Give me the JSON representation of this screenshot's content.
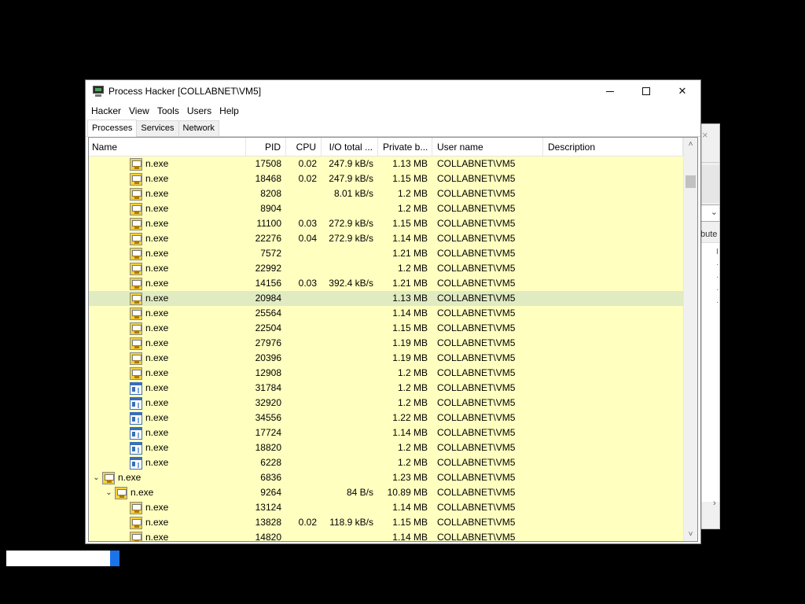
{
  "background_window": {
    "close_glyph": "×",
    "label": "bute",
    "combo_arrow": "⌄",
    "scroll_arrow": "›"
  },
  "window": {
    "title": "Process Hacker [COLLABNET\\VM5]",
    "controls": {
      "minimize": "",
      "maximize": "",
      "close": "✕"
    }
  },
  "menu": [
    "Hacker",
    "View",
    "Tools",
    "Users",
    "Help"
  ],
  "tabs": [
    {
      "label": "Processes",
      "active": true
    },
    {
      "label": "Services",
      "active": false
    },
    {
      "label": "Network",
      "active": false
    }
  ],
  "columns": {
    "name": "Name",
    "pid": "PID",
    "cpu": "CPU",
    "io": "I/O total ...",
    "priv": "Private b...",
    "user": "User name",
    "desc": "Description"
  },
  "colors": {
    "row_highlight": "#ffffc0",
    "selected_row": "#ececb4"
  },
  "rows": [
    {
      "indent": 3,
      "icon": "process-icon",
      "name": "n.exe",
      "pid": "17508",
      "cpu": "0.02",
      "io": "247.9 kB/s",
      "priv": "1.13 MB",
      "user": "COLLABNET\\VM5",
      "desc": ""
    },
    {
      "indent": 3,
      "icon": "process-icon",
      "name": "n.exe",
      "pid": "18468",
      "cpu": "0.02",
      "io": "247.9 kB/s",
      "priv": "1.15 MB",
      "user": "COLLABNET\\VM5",
      "desc": ""
    },
    {
      "indent": 3,
      "icon": "process-icon",
      "name": "n.exe",
      "pid": "8208",
      "cpu": "",
      "io": "8.01 kB/s",
      "priv": "1.2 MB",
      "user": "COLLABNET\\VM5",
      "desc": ""
    },
    {
      "indent": 3,
      "icon": "process-icon",
      "name": "n.exe",
      "pid": "8904",
      "cpu": "",
      "io": "",
      "priv": "1.2 MB",
      "user": "COLLABNET\\VM5",
      "desc": ""
    },
    {
      "indent": 3,
      "icon": "process-icon",
      "name": "n.exe",
      "pid": "11100",
      "cpu": "0.03",
      "io": "272.9 kB/s",
      "priv": "1.15 MB",
      "user": "COLLABNET\\VM5",
      "desc": ""
    },
    {
      "indent": 3,
      "icon": "process-icon",
      "name": "n.exe",
      "pid": "22276",
      "cpu": "0.04",
      "io": "272.9 kB/s",
      "priv": "1.14 MB",
      "user": "COLLABNET\\VM5",
      "desc": ""
    },
    {
      "indent": 3,
      "icon": "process-icon",
      "name": "n.exe",
      "pid": "7572",
      "cpu": "",
      "io": "",
      "priv": "1.21 MB",
      "user": "COLLABNET\\VM5",
      "desc": ""
    },
    {
      "indent": 3,
      "icon": "process-icon",
      "name": "n.exe",
      "pid": "22992",
      "cpu": "",
      "io": "",
      "priv": "1.2 MB",
      "user": "COLLABNET\\VM5",
      "desc": ""
    },
    {
      "indent": 3,
      "icon": "process-icon",
      "name": "n.exe",
      "pid": "14156",
      "cpu": "0.03",
      "io": "392.4 kB/s",
      "priv": "1.21 MB",
      "user": "COLLABNET\\VM5",
      "desc": ""
    },
    {
      "indent": 3,
      "icon": "process-icon",
      "name": "n.exe",
      "pid": "20984",
      "cpu": "",
      "io": "",
      "priv": "1.13 MB",
      "user": "COLLABNET\\VM5",
      "desc": "",
      "selected": true
    },
    {
      "indent": 3,
      "icon": "process-icon",
      "name": "n.exe",
      "pid": "25564",
      "cpu": "",
      "io": "",
      "priv": "1.14 MB",
      "user": "COLLABNET\\VM5",
      "desc": ""
    },
    {
      "indent": 3,
      "icon": "process-icon",
      "name": "n.exe",
      "pid": "22504",
      "cpu": "",
      "io": "",
      "priv": "1.15 MB",
      "user": "COLLABNET\\VM5",
      "desc": ""
    },
    {
      "indent": 3,
      "icon": "process-icon",
      "name": "n.exe",
      "pid": "27976",
      "cpu": "",
      "io": "",
      "priv": "1.19 MB",
      "user": "COLLABNET\\VM5",
      "desc": ""
    },
    {
      "indent": 3,
      "icon": "process-icon",
      "name": "n.exe",
      "pid": "20396",
      "cpu": "",
      "io": "",
      "priv": "1.19 MB",
      "user": "COLLABNET\\VM5",
      "desc": ""
    },
    {
      "indent": 3,
      "icon": "process-icon",
      "name": "n.exe",
      "pid": "12908",
      "cpu": "",
      "io": "",
      "priv": "1.2 MB",
      "user": "COLLABNET\\VM5",
      "desc": ""
    },
    {
      "indent": 3,
      "icon": "window-icon",
      "name": "n.exe",
      "pid": "31784",
      "cpu": "",
      "io": "",
      "priv": "1.2 MB",
      "user": "COLLABNET\\VM5",
      "desc": ""
    },
    {
      "indent": 3,
      "icon": "window-icon",
      "name": "n.exe",
      "pid": "32920",
      "cpu": "",
      "io": "",
      "priv": "1.2 MB",
      "user": "COLLABNET\\VM5",
      "desc": ""
    },
    {
      "indent": 3,
      "icon": "window-icon",
      "name": "n.exe",
      "pid": "34556",
      "cpu": "",
      "io": "",
      "priv": "1.22 MB",
      "user": "COLLABNET\\VM5",
      "desc": ""
    },
    {
      "indent": 3,
      "icon": "window-icon",
      "name": "n.exe",
      "pid": "17724",
      "cpu": "",
      "io": "",
      "priv": "1.14 MB",
      "user": "COLLABNET\\VM5",
      "desc": ""
    },
    {
      "indent": 3,
      "icon": "window-icon",
      "name": "n.exe",
      "pid": "18820",
      "cpu": "",
      "io": "",
      "priv": "1.2 MB",
      "user": "COLLABNET\\VM5",
      "desc": ""
    },
    {
      "indent": 3,
      "icon": "window-icon",
      "name": "n.exe",
      "pid": "6228",
      "cpu": "",
      "io": "",
      "priv": "1.2 MB",
      "user": "COLLABNET\\VM5",
      "desc": ""
    },
    {
      "indent": 0,
      "icon": "process-icon",
      "expander": "expanded",
      "name": "n.exe",
      "pid": "6836",
      "cpu": "",
      "io": "",
      "priv": "1.23 MB",
      "user": "COLLABNET\\VM5",
      "desc": ""
    },
    {
      "indent": 1,
      "icon": "process-icon",
      "expander": "expanded",
      "name": "n.exe",
      "pid": "9264",
      "cpu": "",
      "io": "84 B/s",
      "priv": "10.89 MB",
      "user": "COLLABNET\\VM5",
      "desc": ""
    },
    {
      "indent": 3,
      "icon": "process-icon",
      "name": "n.exe",
      "pid": "13124",
      "cpu": "",
      "io": "",
      "priv": "1.14 MB",
      "user": "COLLABNET\\VM5",
      "desc": ""
    },
    {
      "indent": 3,
      "icon": "process-icon",
      "name": "n.exe",
      "pid": "13828",
      "cpu": "0.02",
      "io": "118.9 kB/s",
      "priv": "1.15 MB",
      "user": "COLLABNET\\VM5",
      "desc": ""
    },
    {
      "indent": 3,
      "icon": "process-icon",
      "name": "n.exe",
      "pid": "14820",
      "cpu": "",
      "io": "",
      "priv": "1.14 MB",
      "user": "COLLABNET\\VM5",
      "desc": ""
    }
  ],
  "scrollbar": {
    "up": "˄",
    "down": "˅"
  }
}
